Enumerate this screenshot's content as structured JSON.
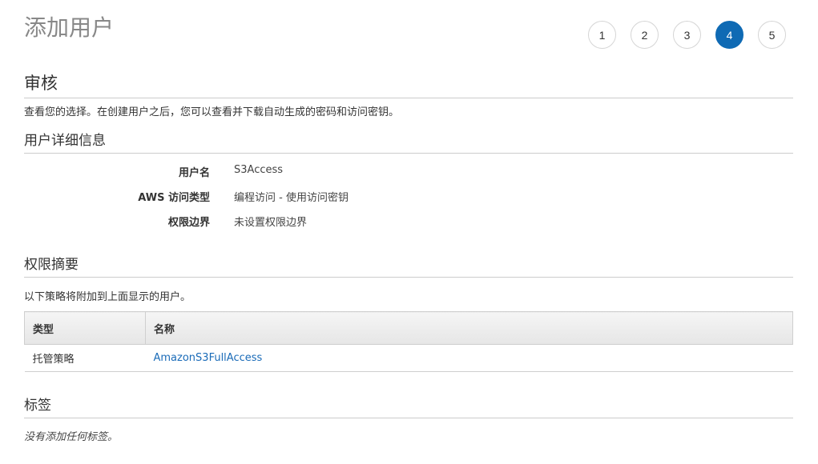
{
  "page_title": "添加用户",
  "steps": [
    {
      "label": "1",
      "active": false
    },
    {
      "label": "2",
      "active": false
    },
    {
      "label": "3",
      "active": false
    },
    {
      "label": "4",
      "active": true
    },
    {
      "label": "5",
      "active": false
    }
  ],
  "review": {
    "title": "审核",
    "description": "查看您的选择。在创建用户之后，您可以查看并下载自动生成的密码和访问密钥。"
  },
  "user_details": {
    "title": "用户详细信息",
    "rows": [
      {
        "label": "用户名",
        "value": "S3Access"
      },
      {
        "label": "AWS 访问类型",
        "value": "编程访问 - 使用访问密钥"
      },
      {
        "label": "权限边界",
        "value": "未设置权限边界"
      }
    ]
  },
  "permissions": {
    "title": "权限摘要",
    "description": "以下策略将附加到上面显示的用户。",
    "columns": [
      "类型",
      "名称"
    ],
    "rows": [
      {
        "type": "托管策略",
        "name": "AmazonS3FullAccess"
      }
    ]
  },
  "tags": {
    "title": "标签",
    "empty_text": "没有添加任何标签。"
  },
  "colors": {
    "accent": "#0f6ab4",
    "link": "#1a6bb8",
    "title_gray": "#888888"
  }
}
